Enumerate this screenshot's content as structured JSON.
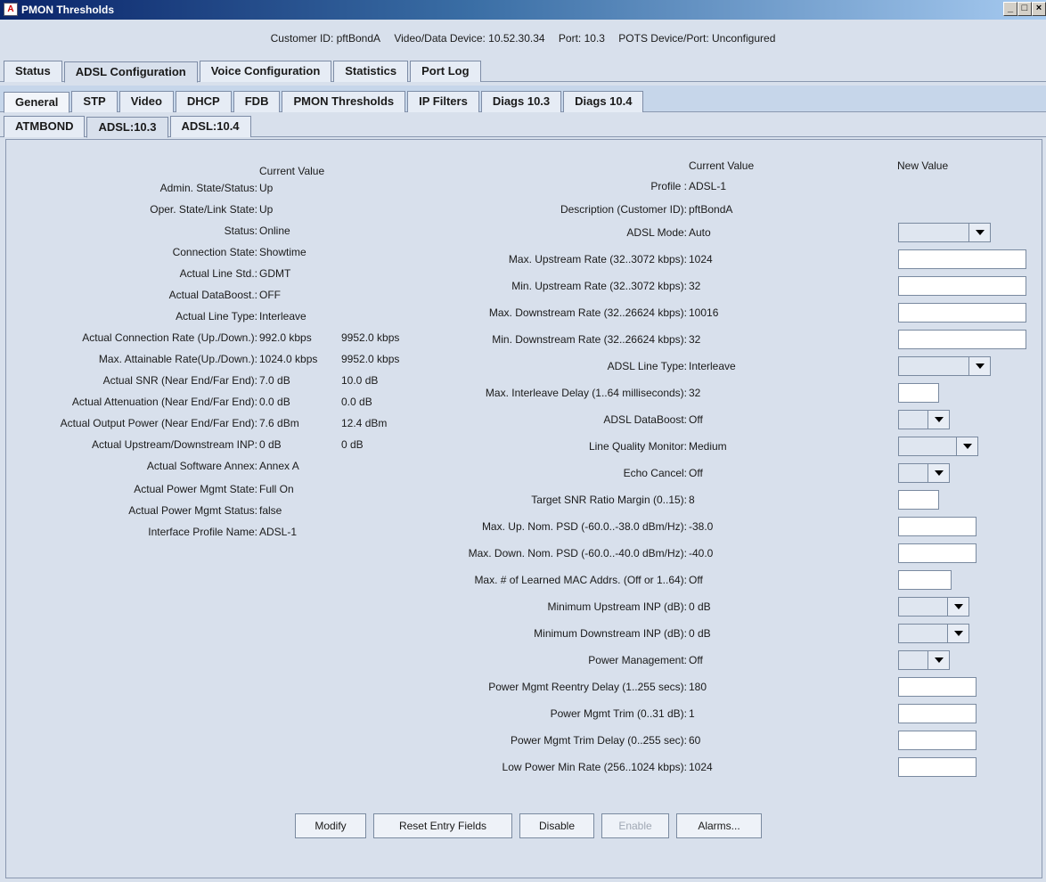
{
  "window": {
    "title": "PMON Thresholds",
    "minimize": "_",
    "maximize": "□",
    "close": "×"
  },
  "info": {
    "customer": "Customer ID: pftBondA",
    "device": "Video/Data Device: 10.52.30.34",
    "port": "Port: 10.3",
    "pots": "POTS Device/Port: Unconfigured"
  },
  "tabs_top": [
    "Status",
    "ADSL Configuration",
    "Voice Configuration",
    "Statistics",
    "Port Log"
  ],
  "tabs_mid": [
    "General",
    "STP",
    "Video",
    "DHCP",
    "FDB",
    "PMON Thresholds",
    "IP Filters",
    "Diags 10.3",
    "Diags 10.4"
  ],
  "tabs_sub": [
    "ATMBOND",
    "ADSL:10.3",
    "ADSL:10.4"
  ],
  "left": {
    "header": "Current Value",
    "rows": [
      {
        "label": "Admin. State/Status:",
        "value": "Up",
        "value2": ""
      },
      {
        "label": "Oper. State/Link State:",
        "value": "Up",
        "value2": ""
      },
      {
        "label": "Status:",
        "value": "Online",
        "value2": ""
      },
      {
        "label": "Connection State:",
        "value": "Showtime",
        "value2": ""
      },
      {
        "label": "Actual Line Std.:",
        "value": "GDMT",
        "value2": ""
      },
      {
        "label": "Actual DataBoost.:",
        "value": "OFF",
        "value2": ""
      },
      {
        "label": "Actual Line Type:",
        "value": "Interleave",
        "value2": ""
      },
      {
        "label": "Actual Connection Rate (Up./Down.):",
        "value": "992.0 kbps",
        "value2": "9952.0 kbps"
      },
      {
        "label": "Max. Attainable Rate(Up./Down.):",
        "value": "1024.0 kbps",
        "value2": "9952.0 kbps"
      },
      {
        "label": "Actual SNR (Near End/Far End):",
        "value": "7.0 dB",
        "value2": "10.0 dB"
      },
      {
        "label": "Actual Attenuation (Near End/Far End):",
        "value": "0.0 dB",
        "value2": "0.0 dB"
      },
      {
        "label": "Actual Output Power (Near End/Far End):",
        "value": "7.6 dBm",
        "value2": "12.4 dBm"
      },
      {
        "label": "Actual Upstream/Downstream INP:",
        "value": "0 dB",
        "value2": "0 dB"
      },
      {
        "label": "Actual Software Annex:",
        "value": "Annex A",
        "value2": ""
      },
      {
        "label": "Actual Power Mgmt State:",
        "value": "Full On",
        "value2": ""
      },
      {
        "label": "Actual Power Mgmt Status:",
        "value": "false",
        "value2": ""
      },
      {
        "label": "Interface Profile Name:",
        "value": "ADSL-1",
        "value2": ""
      }
    ]
  },
  "right": {
    "header_current": "Current Value",
    "header_new": "New Value",
    "rows": [
      {
        "label": "Profile :",
        "value": "ADSL-1",
        "control": "none"
      },
      {
        "label": "Description (Customer ID):",
        "value": "pftBondA",
        "control": "none"
      },
      {
        "label": "ADSL Mode:",
        "value": "Auto",
        "control": "combo",
        "width": 104
      },
      {
        "label": "Max. Upstream Rate (32..3072 kbps):",
        "value": "1024",
        "control": "text",
        "width": 144
      },
      {
        "label": "Min. Upstream Rate (32..3072 kbps):",
        "value": "32",
        "control": "text",
        "width": 144
      },
      {
        "label": "Max. Downstream Rate (32..26624 kbps):",
        "value": "10016",
        "control": "text",
        "width": 144
      },
      {
        "label": "Min. Downstream Rate (32..26624 kbps):",
        "value": "32",
        "control": "text",
        "width": 144
      },
      {
        "label": "ADSL Line Type:",
        "value": "Interleave",
        "control": "combo",
        "width": 104
      },
      {
        "label": "Max. Interleave Delay (1..64 milliseconds):",
        "value": "32",
        "control": "text",
        "width": 46
      },
      {
        "label": "ADSL DataBoost:",
        "value": "Off",
        "control": "combo",
        "width": 58
      },
      {
        "label": "Line Quality Monitor:",
        "value": "Medium",
        "control": "combo",
        "width": 90
      },
      {
        "label": "Echo Cancel:",
        "value": "Off",
        "control": "combo",
        "width": 58
      },
      {
        "label": "Target SNR Ratio Margin (0..15):",
        "value": "8",
        "control": "text",
        "width": 46
      },
      {
        "label": "Max. Up. Nom. PSD (-60.0..-38.0 dBm/Hz):",
        "value": "-38.0",
        "control": "text",
        "width": 88
      },
      {
        "label": "Max. Down. Nom. PSD (-60.0..-40.0 dBm/Hz):",
        "value": "-40.0",
        "control": "text",
        "width": 88
      },
      {
        "label": "Max. # of Learned MAC Addrs. (Off or 1..64):",
        "value": "Off",
        "control": "text",
        "width": 60
      },
      {
        "label": "Minimum Upstream INP (dB):",
        "value": "0 dB",
        "control": "combo",
        "width": 80
      },
      {
        "label": "Minimum Downstream INP (dB):",
        "value": "0 dB",
        "control": "combo",
        "width": 80
      },
      {
        "label": "Power Management:",
        "value": "Off",
        "control": "combo",
        "width": 58
      },
      {
        "label": "Power Mgmt Reentry Delay (1..255 secs):",
        "value": "180",
        "control": "text",
        "width": 88
      },
      {
        "label": "Power Mgmt Trim (0..31 dB):",
        "value": "1",
        "control": "text",
        "width": 88
      },
      {
        "label": "Power Mgmt Trim Delay (0..255 sec):",
        "value": "60",
        "control": "text",
        "width": 88
      },
      {
        "label": "Low Power Min Rate (256..1024 kbps):",
        "value": "1024",
        "control": "text",
        "width": 88
      }
    ]
  },
  "buttons": [
    {
      "label": "Modify",
      "enabled": true,
      "width": 80
    },
    {
      "label": "Reset Entry Fields",
      "enabled": true,
      "width": 156
    },
    {
      "label": "Disable",
      "enabled": true,
      "width": 84
    },
    {
      "label": "Enable",
      "enabled": false,
      "width": 76
    },
    {
      "label": "Alarms...",
      "enabled": true,
      "width": 96
    }
  ]
}
